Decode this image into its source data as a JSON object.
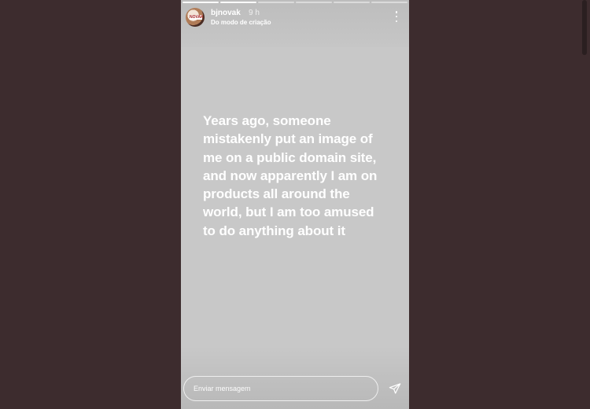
{
  "story": {
    "progress_segments": [
      {
        "state": "done"
      },
      {
        "state": "done"
      },
      {
        "state": "pending"
      },
      {
        "state": "pending"
      },
      {
        "state": "pending"
      },
      {
        "state": "pending"
      }
    ],
    "header": {
      "username": "bjnovak",
      "time": "9 h",
      "subtitle": "Do modo de criação",
      "more_icon": "more-vertical-icon"
    },
    "text": "Years ago, someone mistakenly put an image of me on a public domain site, and now apparently I am on products all around the world, but I am too amused to do anything about it",
    "reply": {
      "placeholder": "Enviar mensagem",
      "value": "",
      "send_icon": "send-paper-plane-icon"
    }
  },
  "colors": {
    "page_background": "#3d2c2e",
    "story_background": "#c8c8c8",
    "text": "#ffffff"
  }
}
